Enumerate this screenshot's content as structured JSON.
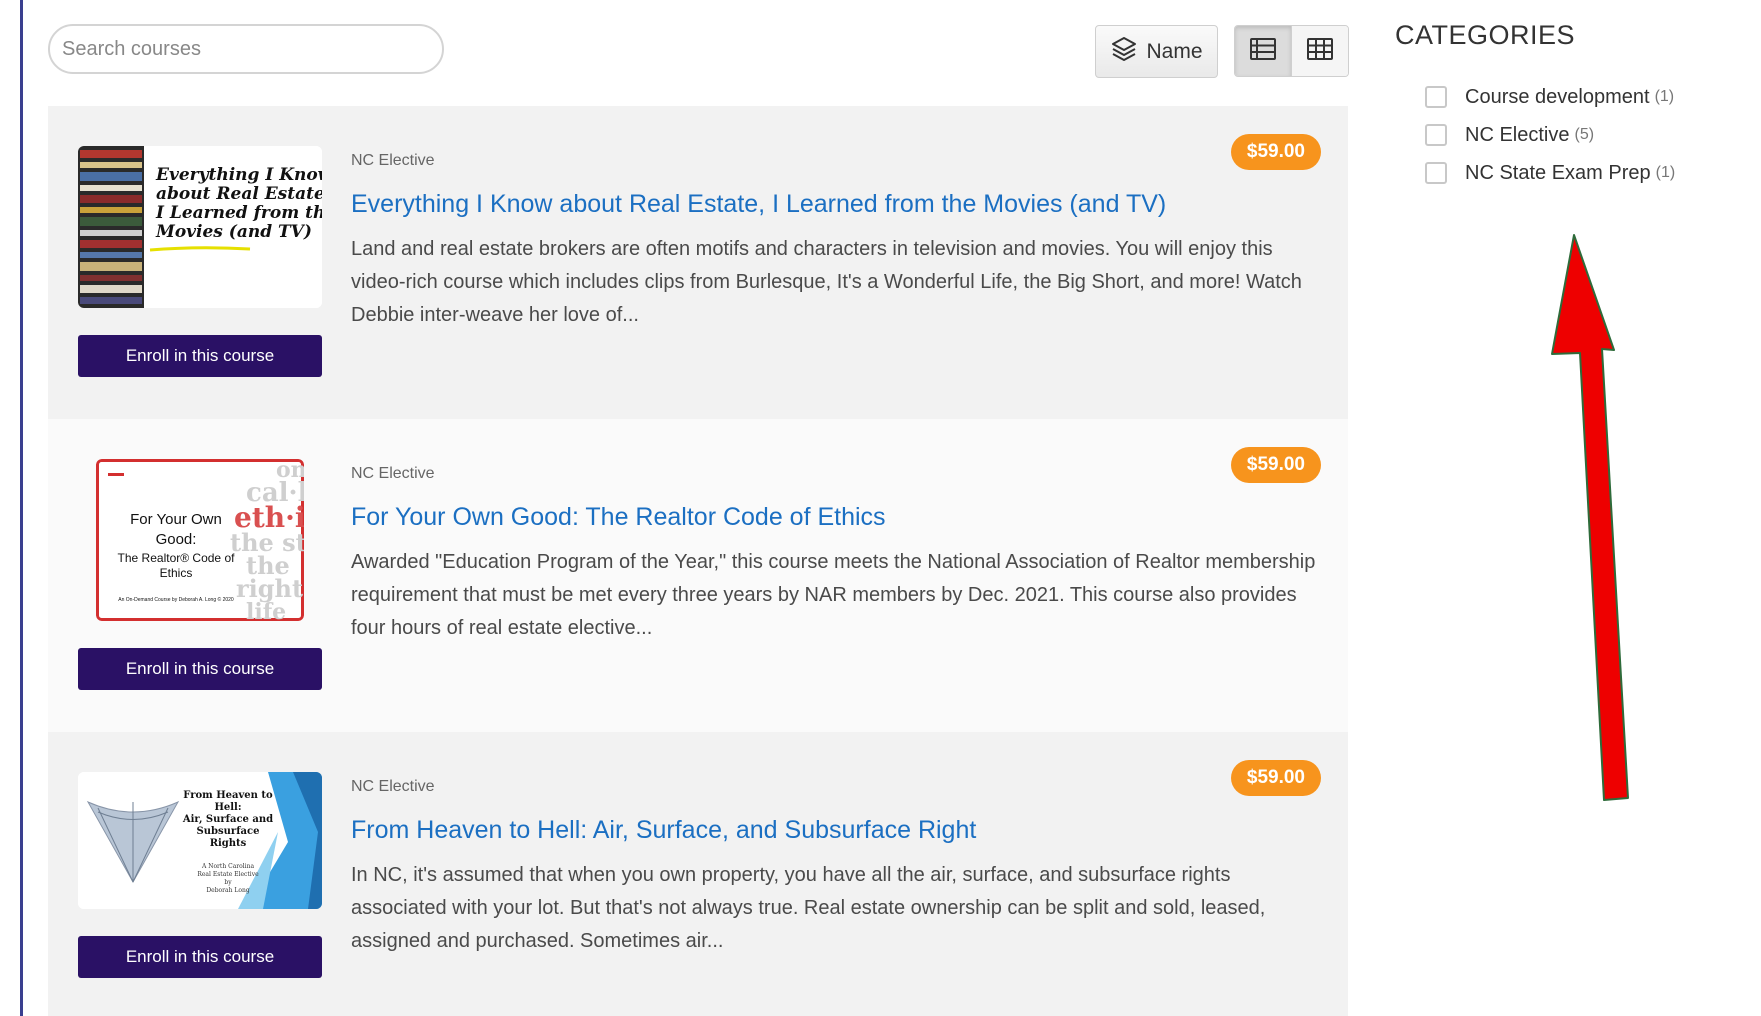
{
  "search": {
    "placeholder": "Search courses"
  },
  "toolbar": {
    "sort_label": "Name"
  },
  "courses": [
    {
      "category": "NC Elective",
      "price": "$59.00",
      "title": "Everything I Know about Real Estate, I Learned from the Movies (and TV)",
      "description": "Land and real estate brokers are often motifs and characters in television and movies. You will enjoy this video-rich course which includes clips from Burlesque, It's a Wonderful Life, the Big Short, and more! Watch Debbie inter-weave her love of...",
      "enroll_label": "Enroll in this course",
      "thumb_lines": [
        "Everything I Know",
        "about Real Estate,",
        "I Learned from the",
        "Movies (and TV)"
      ]
    },
    {
      "category": "NC Elective",
      "price": "$59.00",
      "title": "For Your Own Good: The Realtor Code of Ethics",
      "description": "Awarded \"Education Program of the Year,\" this course meets the National Association of Realtor membership requirement that must be met every three years by NAR members by Dec. 2021. This course also provides four hours of real estate elective...",
      "enroll_label": "Enroll in this course",
      "thumb_lines": [
        "For Your Own",
        "Good:",
        "The Realtor® Code of",
        "Ethics"
      ],
      "thumb_small": "An On-Demand Course by Deborah A. Long © 2020",
      "thumb_bg_words": [
        "ondi",
        "cal·ly",
        "eth·ics",
        "the stu",
        "the",
        "right",
        "life"
      ]
    },
    {
      "category": "NC Elective",
      "price": "$59.00",
      "title": "From Heaven to Hell: Air, Surface, and Subsurface Right",
      "description": "In NC, it's assumed that when you own property, you have all the air, surface, and subsurface rights associated with your lot. But that's not always true. Real estate ownership can be split and sold, leased, assigned and purchased. Sometimes air...",
      "enroll_label": "Enroll in this course",
      "thumb_lines": [
        "From Heaven to",
        "Hell:",
        "Air, Surface and",
        "Subsurface",
        "Rights"
      ],
      "thumb_sub": [
        "A North Carolina",
        "Real Estate Elective",
        "by",
        "Deborah Long"
      ]
    }
  ],
  "sidebar": {
    "heading": "CATEGORIES",
    "categories": [
      {
        "name": "Course development",
        "count": "(1)"
      },
      {
        "name": "NC Elective",
        "count": "(5)"
      },
      {
        "name": "NC State Exam Prep",
        "count": "(1)"
      }
    ]
  },
  "icons": {
    "sort": "layers-icon",
    "list_view": "list-view-icon",
    "grid_view": "grid-view-icon",
    "annotation": "red-arrow-up"
  },
  "colors": {
    "link": "#1b6fc2",
    "price_badge": "#f7941d",
    "enroll_button": "#2a1165",
    "annotation_arrow": "#ee0000"
  }
}
